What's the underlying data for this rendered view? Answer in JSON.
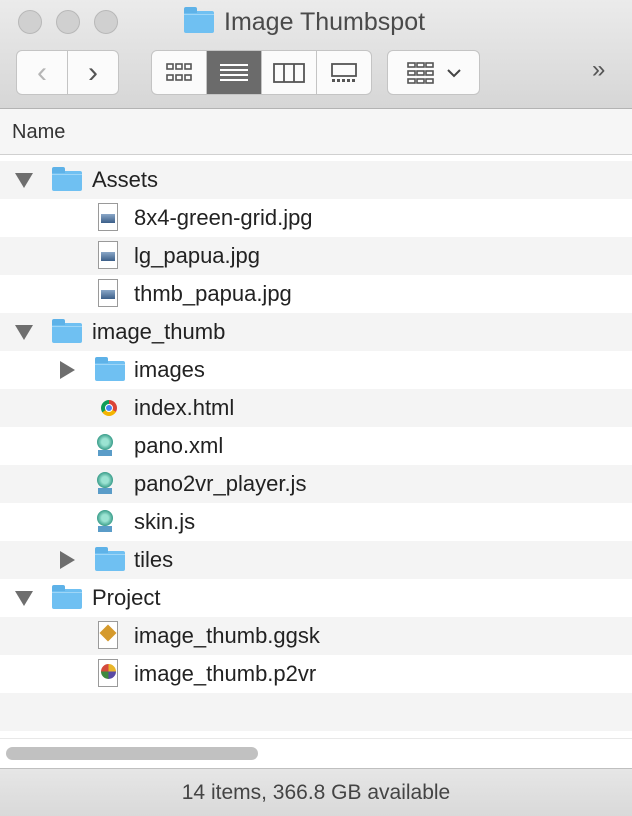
{
  "window": {
    "title": "Image Thumbspot"
  },
  "toolbar": {
    "back_glyph": "‹",
    "forward_glyph": "›",
    "more_glyph": "»",
    "view_modes": [
      "icon-view",
      "list-view",
      "column-view",
      "gallery-view"
    ],
    "active_view": "list-view"
  },
  "column_header": {
    "name": "Name"
  },
  "rows": [
    {
      "label": "Assets",
      "type": "folder",
      "level": 0,
      "state": "expanded"
    },
    {
      "label": "8x4-green-grid.jpg",
      "type": "image-file",
      "level": 1
    },
    {
      "label": "lg_papua.jpg",
      "type": "image-file",
      "level": 1
    },
    {
      "label": "thmb_papua.jpg",
      "type": "image-file",
      "level": 1
    },
    {
      "label": "image_thumb",
      "type": "folder",
      "level": 0,
      "state": "expanded"
    },
    {
      "label": "images",
      "type": "folder",
      "level": 1,
      "state": "collapsed"
    },
    {
      "label": "index.html",
      "type": "html-file",
      "level": 1
    },
    {
      "label": "pano.xml",
      "type": "text-file",
      "level": 1
    },
    {
      "label": "pano2vr_player.js",
      "type": "text-file",
      "level": 1
    },
    {
      "label": "skin.js",
      "type": "text-file",
      "level": 1
    },
    {
      "label": "tiles",
      "type": "folder",
      "level": 1,
      "state": "collapsed"
    },
    {
      "label": "Project",
      "type": "folder",
      "level": 0,
      "state": "expanded"
    },
    {
      "label": "image_thumb.ggsk",
      "type": "skin-file",
      "level": 1
    },
    {
      "label": "image_thumb.p2vr",
      "type": "pano-file",
      "level": 1
    }
  ],
  "status": {
    "text": "14 items, 366.8 GB available"
  },
  "colors": {
    "folder": "#6fc0f2",
    "active_view_bg": "#6b6b6b"
  }
}
